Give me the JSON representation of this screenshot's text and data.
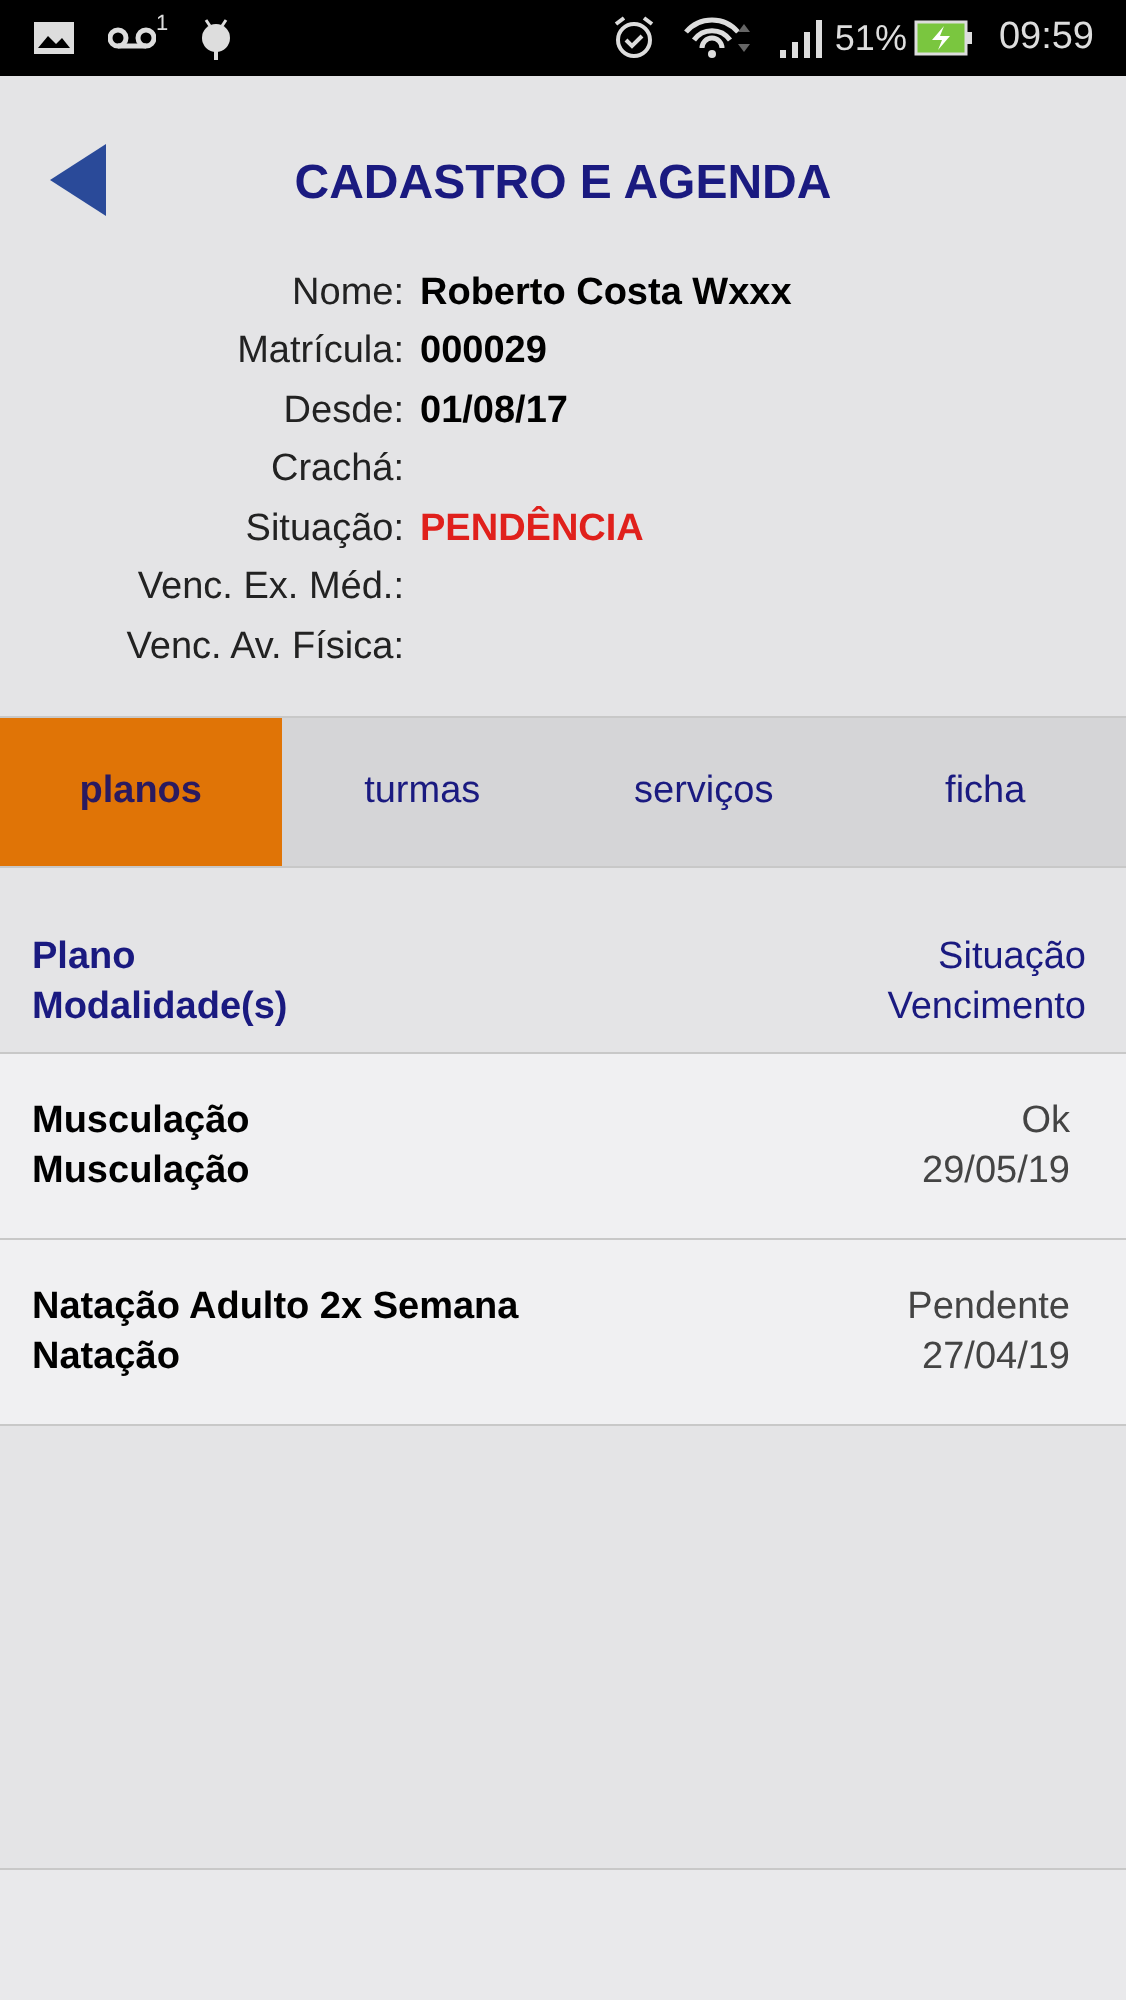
{
  "status_bar": {
    "voicemail_count": "1",
    "battery": "51%",
    "time": "09:59"
  },
  "header": {
    "title": "CADASTRO E AGENDA"
  },
  "fields": [
    {
      "label": "Nome:",
      "value": "Roberto Costa Wxxx",
      "kind": "normal"
    },
    {
      "label": "Matrícula:",
      "value": "000029",
      "kind": "normal"
    },
    {
      "label": "Desde:",
      "value": "01/08/17",
      "kind": "normal"
    },
    {
      "label": "Crachá:"
    },
    {
      "label": "Situação:",
      "value": "PENDÊNCIA",
      "kind": "alert"
    },
    {
      "label": "Venc. Ex. Méd.:"
    },
    {
      "label": "Venc. Av. Física:"
    }
  ],
  "tabs": [
    {
      "label": "planos",
      "selected": true
    },
    {
      "label": "turmas",
      "selected": false
    },
    {
      "label": "serviços",
      "selected": false
    },
    {
      "label": "ficha",
      "selected": false
    }
  ],
  "table": {
    "columns": {
      "left": [
        "Plano",
        "Modalidade(s)"
      ],
      "right": [
        "Situação",
        "Vencimento"
      ]
    },
    "rows": [
      {
        "plano": "Musculação",
        "modalidade": "Musculação",
        "situacao": "Ok",
        "vencimento": "29/05/19"
      },
      {
        "plano": "Natação Adulto 2x Semana",
        "modalidade": "Natação",
        "situacao": "Pendente",
        "vencimento": "27/04/19"
      }
    ]
  }
}
